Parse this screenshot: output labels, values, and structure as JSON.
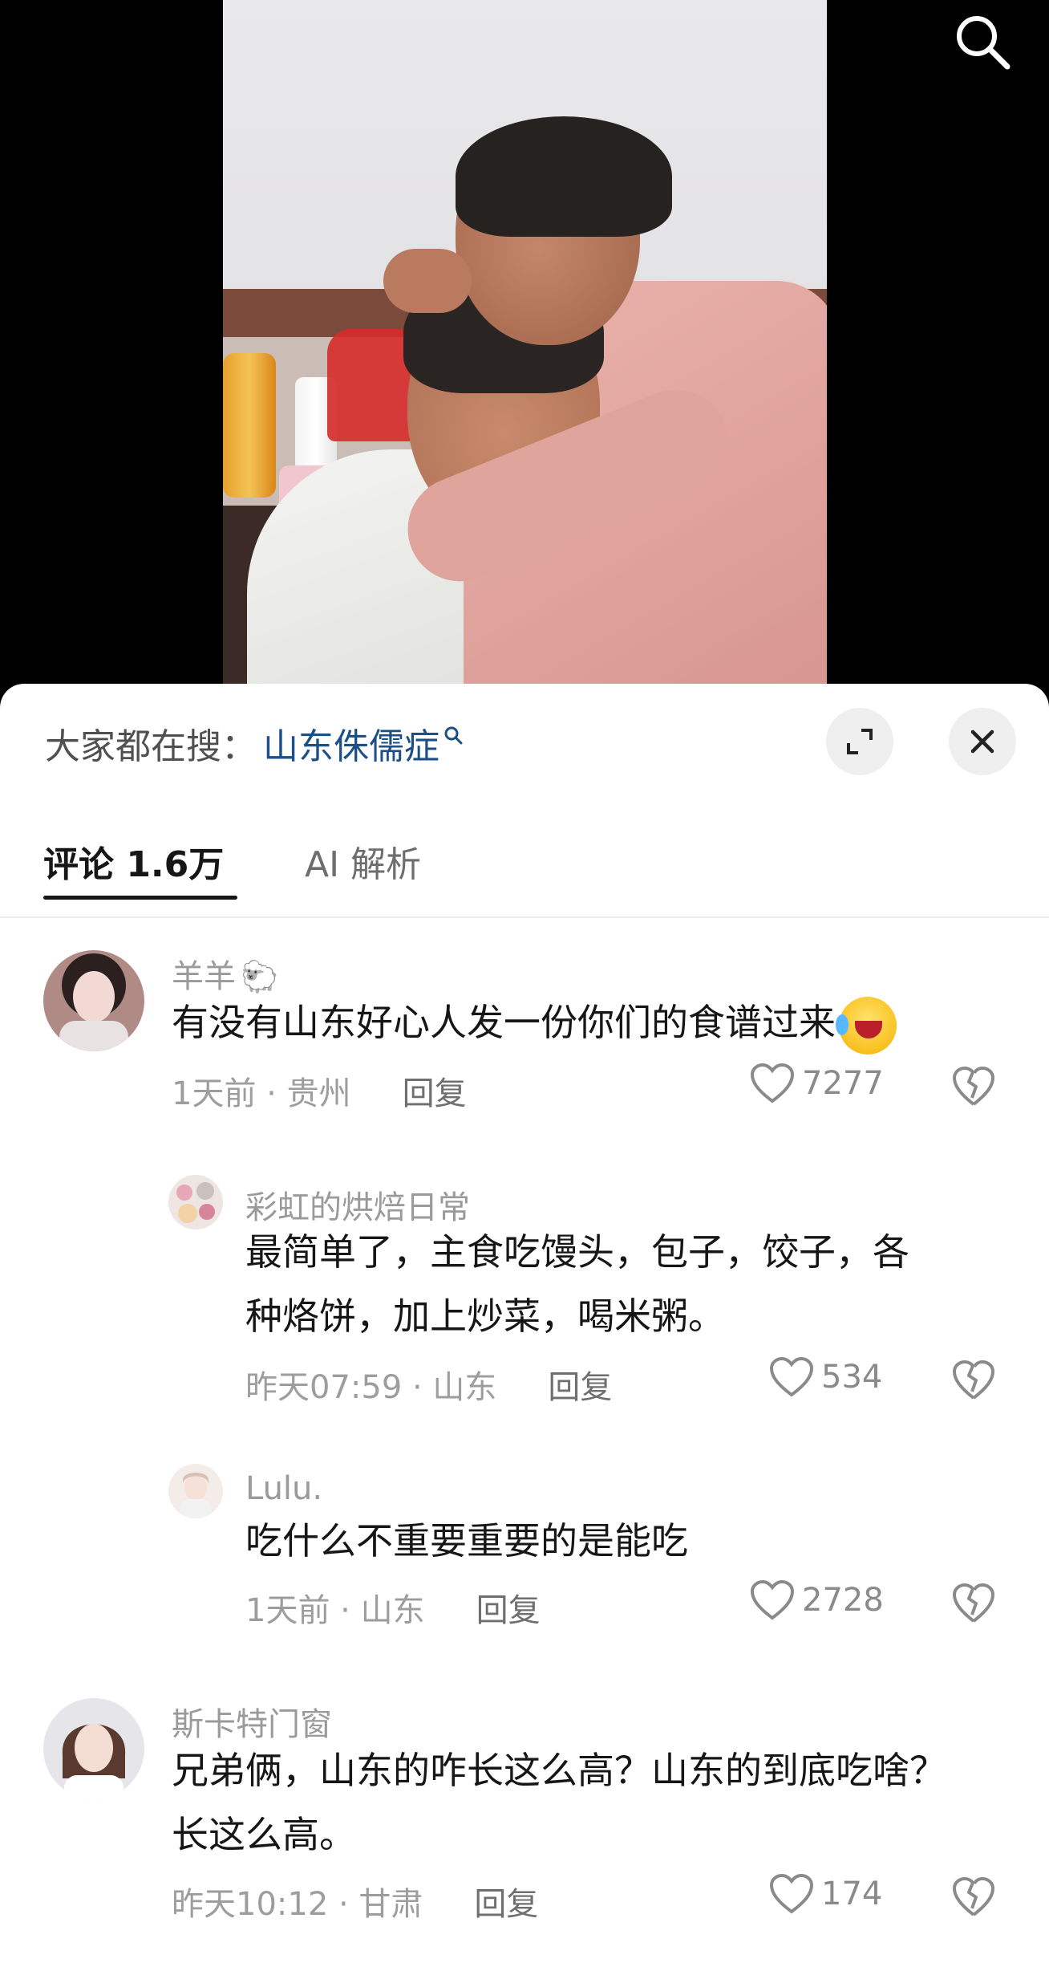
{
  "colors": {
    "trending_query": "#1b4f86",
    "text_primary": "#161616",
    "text_secondary": "#9d9d9d",
    "button_bg": "#efefef"
  },
  "video": {
    "search_icon": "search-icon"
  },
  "sheet": {
    "trending_prefix": "大家都在搜：",
    "trending_query": "山东侏儒症",
    "expand_icon": "expand-icon",
    "close_icon": "close-icon",
    "tabs": [
      {
        "label": "评论 1.6万",
        "active": true
      },
      {
        "label": "AI 解析",
        "active": false
      }
    ]
  },
  "comments": [
    {
      "username": "羊羊",
      "username_badge": "sheep-emoji",
      "text": "有没有山东好心人发一份你们的食谱过来",
      "text_emoji": "laugh-cry-emoji",
      "time_location": "1天前 · 贵州",
      "reply_label": "回复",
      "likes": "7277"
    },
    {
      "username": "彩虹的烘焙日常",
      "text_line1": "最简单了，主食吃馒头，包子，饺子，各",
      "text_line2": "种烙饼，加上炒菜，喝米粥。",
      "time_location": "昨天07:59 · 山东",
      "reply_label": "回复",
      "likes": "534"
    },
    {
      "username": "Lulu.",
      "text": "吃什么不重要重要的是能吃",
      "time_location": "1天前 · 山东",
      "reply_label": "回复",
      "likes": "2728"
    },
    {
      "username": "斯卡特门窗",
      "text_line1": "兄弟俩，山东的咋长这么高？山东的到底吃啥？",
      "text_line2": "长这么高。",
      "time_location": "昨天10:12 · 甘肃",
      "reply_label": "回复",
      "likes": "174"
    }
  ]
}
